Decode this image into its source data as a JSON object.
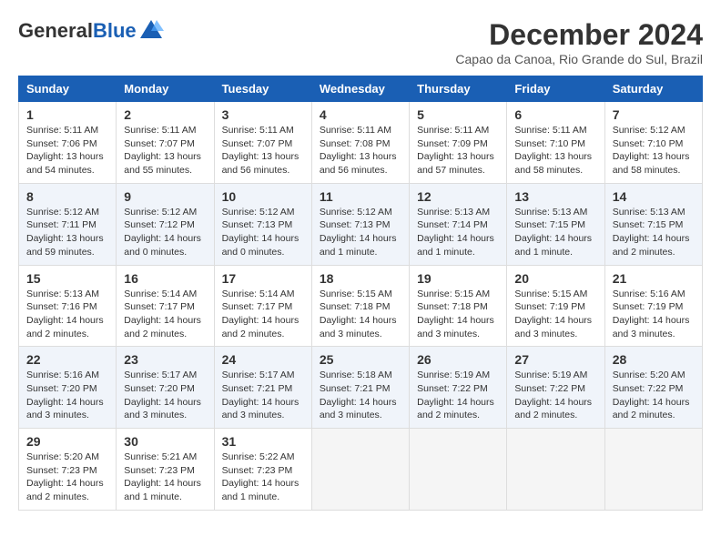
{
  "header": {
    "logo_general": "General",
    "logo_blue": "Blue",
    "month_title": "December 2024",
    "location": "Capao da Canoa, Rio Grande do Sul, Brazil"
  },
  "weekdays": [
    "Sunday",
    "Monday",
    "Tuesday",
    "Wednesday",
    "Thursday",
    "Friday",
    "Saturday"
  ],
  "weeks": [
    [
      {
        "day": "1",
        "info": "Sunrise: 5:11 AM\nSunset: 7:06 PM\nDaylight: 13 hours\nand 54 minutes."
      },
      {
        "day": "2",
        "info": "Sunrise: 5:11 AM\nSunset: 7:07 PM\nDaylight: 13 hours\nand 55 minutes."
      },
      {
        "day": "3",
        "info": "Sunrise: 5:11 AM\nSunset: 7:07 PM\nDaylight: 13 hours\nand 56 minutes."
      },
      {
        "day": "4",
        "info": "Sunrise: 5:11 AM\nSunset: 7:08 PM\nDaylight: 13 hours\nand 56 minutes."
      },
      {
        "day": "5",
        "info": "Sunrise: 5:11 AM\nSunset: 7:09 PM\nDaylight: 13 hours\nand 57 minutes."
      },
      {
        "day": "6",
        "info": "Sunrise: 5:11 AM\nSunset: 7:10 PM\nDaylight: 13 hours\nand 58 minutes."
      },
      {
        "day": "7",
        "info": "Sunrise: 5:12 AM\nSunset: 7:10 PM\nDaylight: 13 hours\nand 58 minutes."
      }
    ],
    [
      {
        "day": "8",
        "info": "Sunrise: 5:12 AM\nSunset: 7:11 PM\nDaylight: 13 hours\nand 59 minutes."
      },
      {
        "day": "9",
        "info": "Sunrise: 5:12 AM\nSunset: 7:12 PM\nDaylight: 14 hours\nand 0 minutes."
      },
      {
        "day": "10",
        "info": "Sunrise: 5:12 AM\nSunset: 7:13 PM\nDaylight: 14 hours\nand 0 minutes."
      },
      {
        "day": "11",
        "info": "Sunrise: 5:12 AM\nSunset: 7:13 PM\nDaylight: 14 hours\nand 1 minute."
      },
      {
        "day": "12",
        "info": "Sunrise: 5:13 AM\nSunset: 7:14 PM\nDaylight: 14 hours\nand 1 minute."
      },
      {
        "day": "13",
        "info": "Sunrise: 5:13 AM\nSunset: 7:15 PM\nDaylight: 14 hours\nand 1 minute."
      },
      {
        "day": "14",
        "info": "Sunrise: 5:13 AM\nSunset: 7:15 PM\nDaylight: 14 hours\nand 2 minutes."
      }
    ],
    [
      {
        "day": "15",
        "info": "Sunrise: 5:13 AM\nSunset: 7:16 PM\nDaylight: 14 hours\nand 2 minutes."
      },
      {
        "day": "16",
        "info": "Sunrise: 5:14 AM\nSunset: 7:17 PM\nDaylight: 14 hours\nand 2 minutes."
      },
      {
        "day": "17",
        "info": "Sunrise: 5:14 AM\nSunset: 7:17 PM\nDaylight: 14 hours\nand 2 minutes."
      },
      {
        "day": "18",
        "info": "Sunrise: 5:15 AM\nSunset: 7:18 PM\nDaylight: 14 hours\nand 3 minutes."
      },
      {
        "day": "19",
        "info": "Sunrise: 5:15 AM\nSunset: 7:18 PM\nDaylight: 14 hours\nand 3 minutes."
      },
      {
        "day": "20",
        "info": "Sunrise: 5:15 AM\nSunset: 7:19 PM\nDaylight: 14 hours\nand 3 minutes."
      },
      {
        "day": "21",
        "info": "Sunrise: 5:16 AM\nSunset: 7:19 PM\nDaylight: 14 hours\nand 3 minutes."
      }
    ],
    [
      {
        "day": "22",
        "info": "Sunrise: 5:16 AM\nSunset: 7:20 PM\nDaylight: 14 hours\nand 3 minutes."
      },
      {
        "day": "23",
        "info": "Sunrise: 5:17 AM\nSunset: 7:20 PM\nDaylight: 14 hours\nand 3 minutes."
      },
      {
        "day": "24",
        "info": "Sunrise: 5:17 AM\nSunset: 7:21 PM\nDaylight: 14 hours\nand 3 minutes."
      },
      {
        "day": "25",
        "info": "Sunrise: 5:18 AM\nSunset: 7:21 PM\nDaylight: 14 hours\nand 3 minutes."
      },
      {
        "day": "26",
        "info": "Sunrise: 5:19 AM\nSunset: 7:22 PM\nDaylight: 14 hours\nand 2 minutes."
      },
      {
        "day": "27",
        "info": "Sunrise: 5:19 AM\nSunset: 7:22 PM\nDaylight: 14 hours\nand 2 minutes."
      },
      {
        "day": "28",
        "info": "Sunrise: 5:20 AM\nSunset: 7:22 PM\nDaylight: 14 hours\nand 2 minutes."
      }
    ],
    [
      {
        "day": "29",
        "info": "Sunrise: 5:20 AM\nSunset: 7:23 PM\nDaylight: 14 hours\nand 2 minutes."
      },
      {
        "day": "30",
        "info": "Sunrise: 5:21 AM\nSunset: 7:23 PM\nDaylight: 14 hours\nand 1 minute."
      },
      {
        "day": "31",
        "info": "Sunrise: 5:22 AM\nSunset: 7:23 PM\nDaylight: 14 hours\nand 1 minute."
      },
      {
        "day": "",
        "info": ""
      },
      {
        "day": "",
        "info": ""
      },
      {
        "day": "",
        "info": ""
      },
      {
        "day": "",
        "info": ""
      }
    ]
  ]
}
